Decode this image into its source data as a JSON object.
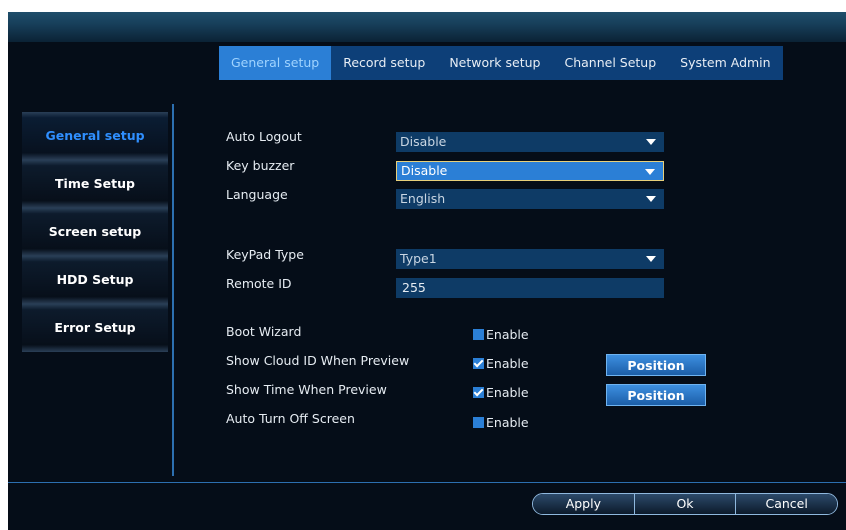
{
  "tabs": [
    "General setup",
    "Record setup",
    "Network setup",
    "Channel Setup",
    "System Admin"
  ],
  "active_tab": "General setup",
  "sidebar": [
    "General setup",
    "Time Setup",
    "Screen setup",
    "HDD Setup",
    "Error Setup"
  ],
  "fields": {
    "auto_logout": {
      "label": "Auto Logout",
      "value": "Disable"
    },
    "key_buzzer": {
      "label": "Key buzzer",
      "value": "Disable"
    },
    "language": {
      "label": "Language",
      "value": "English"
    },
    "keypad_type": {
      "label": "KeyPad Type",
      "value": "Type1"
    },
    "remote_id": {
      "label": "Remote ID",
      "value": "255"
    }
  },
  "checks": {
    "boot_wizard": {
      "label": "Boot Wizard",
      "option": "Enable",
      "checked": false
    },
    "show_cloud_id": {
      "label": "Show Cloud ID When Preview",
      "option": "Enable",
      "checked": true,
      "button": "Position"
    },
    "show_time": {
      "label": "Show Time When Preview",
      "option": "Enable",
      "checked": true,
      "button": "Position"
    },
    "auto_turn_off": {
      "label": "Auto Turn Off Screen",
      "option": "Enable",
      "checked": false
    }
  },
  "footer": {
    "apply": "Apply",
    "ok": "Ok",
    "cancel": "Cancel"
  },
  "colors": {
    "accent": "#2b7fd6",
    "tab_bg": "#0d3f78",
    "background": "#050d18",
    "sidebar_active_text": "#2f8fff"
  }
}
